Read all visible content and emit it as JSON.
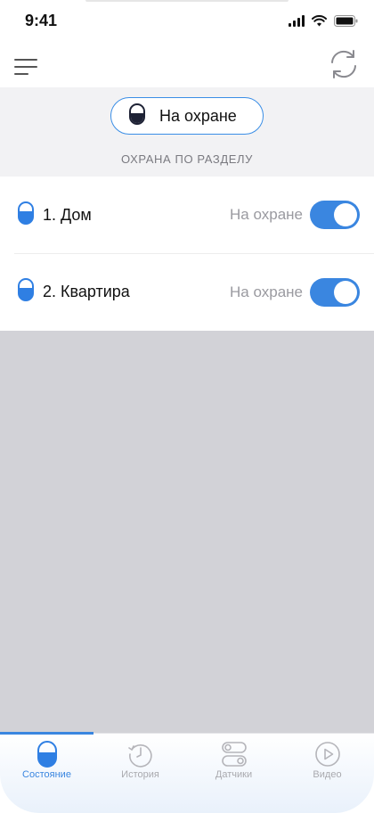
{
  "status_bar": {
    "time": "9:41",
    "icons": [
      "cellular-signal-icon",
      "wifi-icon",
      "battery-icon"
    ]
  },
  "header": {
    "menu_icon": "hamburger-menu-icon",
    "refresh_icon": "refresh-icon"
  },
  "summary": {
    "arm_button_label": "На охране",
    "arm_button_icon": "lock-icon",
    "caption": "ОХРАНА ПО РАЗДЕЛУ"
  },
  "partitions": [
    {
      "name": "1. Дом",
      "status": "На охране",
      "armed": true,
      "icon": "lock-icon"
    },
    {
      "name": "2. Квартира",
      "status": "На охране",
      "armed": true,
      "icon": "lock-icon"
    }
  ],
  "tabbar": {
    "tabs": [
      {
        "label": "Состояние",
        "icon": "lock-icon",
        "active": true
      },
      {
        "label": "История",
        "icon": "history-clock-icon",
        "active": false
      },
      {
        "label": "Датчики",
        "icon": "sensors-toggle-icon",
        "active": false
      },
      {
        "label": "Видео",
        "icon": "play-icon",
        "active": false
      }
    ]
  },
  "colors": {
    "accent": "#3a86e0",
    "muted_text": "#9a9aa0",
    "summary_bg": "#f2f2f4",
    "empty_area_bg": "#d2d2d7"
  }
}
